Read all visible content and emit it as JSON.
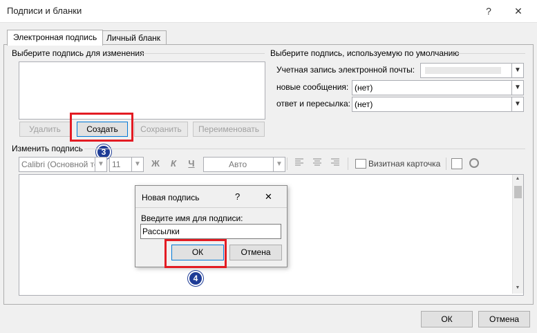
{
  "window": {
    "title": "Подписи и бланки",
    "help": "?",
    "close": "✕"
  },
  "tabs": [
    {
      "label": "Электронная подпись"
    },
    {
      "label": "Личный бланк"
    }
  ],
  "signatures": {
    "select_label": "Выберите подпись для изменения",
    "buttons": {
      "delete": "Удалить",
      "create": "Создать",
      "save": "Сохранить",
      "rename": "Переименовать"
    }
  },
  "defaults": {
    "label": "Выберите подпись, используемую по умолчанию",
    "account_label": "Учетная запись электронной почты:",
    "new_messages_label": "новые сообщения:",
    "new_messages_value": "(нет)",
    "replies_label": "ответ и пересылка:",
    "replies_value": "(нет)"
  },
  "editor": {
    "label": "Изменить подпись",
    "font": "Calibri (Основной те",
    "size": "11",
    "bold": "Ж",
    "italic": "К",
    "underline": "Ч",
    "color": "Авто",
    "business_card": "Визитная карточка"
  },
  "dialog": {
    "title": "Новая подпись",
    "help": "?",
    "close": "✕",
    "prompt": "Введите имя для подписи:",
    "input_value": "Рассылки",
    "ok": "ОК",
    "cancel": "Отмена"
  },
  "footer": {
    "ok": "ОК",
    "cancel": "Отмена"
  },
  "steps": {
    "step3": "3",
    "step4": "4"
  },
  "colors": {
    "highlight": "#e31b23",
    "step_badge": "#1e3c96",
    "focus": "#0078d7"
  }
}
